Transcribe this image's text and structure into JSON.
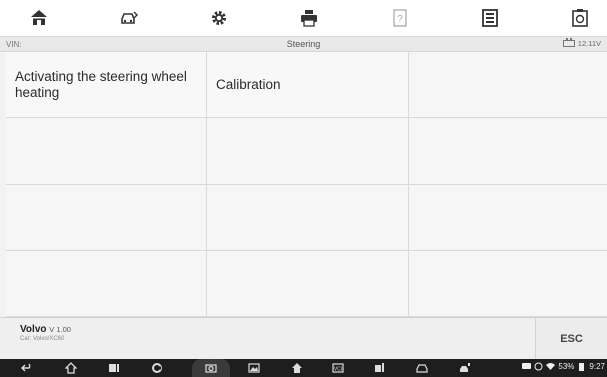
{
  "toolbar": {
    "icons": [
      "home-icon",
      "vehicle-swap-icon",
      "settings-gear-icon",
      "print-icon",
      "help-icon",
      "save-icon",
      "data-logging-icon"
    ]
  },
  "subheader": {
    "vin_label": "VIN:",
    "title": "Steering",
    "voltage": "12.11V"
  },
  "grid": {
    "cells": [
      "Activating the steering wheel heating",
      "Calibration",
      "",
      "",
      "",
      "",
      "",
      "",
      "",
      "",
      "",
      ""
    ]
  },
  "footer": {
    "vehicle_make": "Volvo",
    "vehicle_version": "V 1.00",
    "vehicle_car": "Car: Volvo/XC60",
    "esc_label": "ESC"
  },
  "navbar": {
    "battery_percent": "53%",
    "time": "9:27"
  }
}
